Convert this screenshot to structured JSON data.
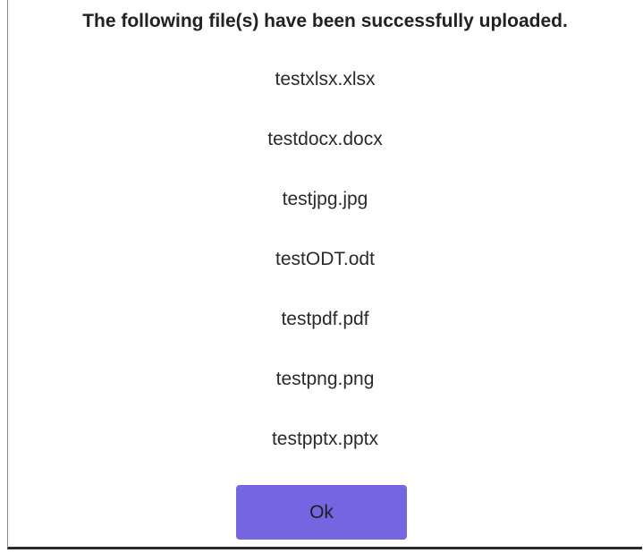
{
  "dialog": {
    "title": "The following file(s) have been successfully uploaded.",
    "files": [
      "testxlsx.xlsx",
      "testdocx.docx",
      "testjpg.jpg",
      "testODT.odt",
      "testpdf.pdf",
      "testpng.png",
      "testpptx.pptx"
    ],
    "ok_label": "Ok",
    "colors": {
      "button_bg": "#7565e0",
      "text": "#222222"
    }
  }
}
